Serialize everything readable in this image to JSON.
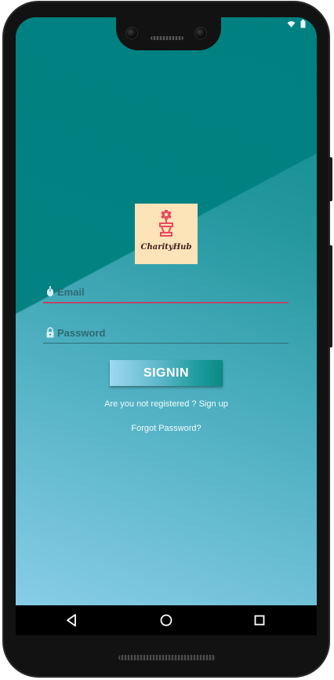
{
  "app": {
    "logo_text": "CharityHub",
    "logo_icon": "flower-pot-icon"
  },
  "status_bar": {
    "time": "",
    "icons": [
      "wifi-icon",
      "battery-icon"
    ]
  },
  "form": {
    "email": {
      "placeholder": "Email",
      "value": "",
      "icon": "email-icon",
      "underline_color": "#b8476c"
    },
    "password": {
      "placeholder": "Password",
      "value": "",
      "icon": "lock-icon"
    },
    "signin_label": "SIGNIN",
    "signup_link": "Are you not registered ? Sign up",
    "forgot_link": "Forgot Password?"
  },
  "nav_bar": {
    "back_icon": "back-triangle-icon",
    "home_icon": "home-circle-icon",
    "recents_icon": "recents-square-icon"
  },
  "colors": {
    "primary": "#008080",
    "logo_background": "#fde3b8",
    "logo_accent": "#e84a5f",
    "text_light": "#ffffff"
  }
}
